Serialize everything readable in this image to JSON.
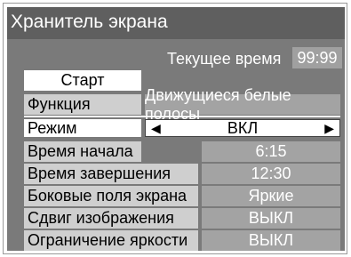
{
  "window": {
    "title": "Хранитель экрана"
  },
  "clock": {
    "label": "Текущее время",
    "value": "99:99"
  },
  "start_button": "Старт",
  "rows": [
    {
      "label": "Функция",
      "value": "Движущиеся белые полосы"
    },
    {
      "label": "Режим",
      "value": "ВКЛ"
    },
    {
      "label": "Время начала",
      "value": "6:15"
    },
    {
      "label": "Время завершения",
      "value": "12:30"
    },
    {
      "label": "Боковые поля экрана",
      "value": "Яркие"
    },
    {
      "label": "Сдвиг изображения",
      "value": "ВЫКЛ"
    },
    {
      "label": "Ограничение яркости",
      "value": "ВЫКЛ"
    }
  ],
  "colors": {
    "title_bg": "#5f5f5f",
    "panel_bg": "#7a7a7a",
    "label_bg": "#cfcfcf",
    "value_bg": "#a3a3a3"
  }
}
